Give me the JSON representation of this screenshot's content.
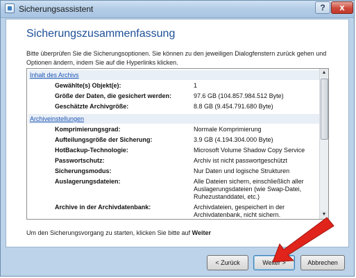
{
  "window": {
    "title": "Sicherungsassistent",
    "help_symbol": "?",
    "close_symbol": "x"
  },
  "page": {
    "title": "Sicherungszusammenfassung",
    "intro": "Bitte überprüfen Sie die Sicherungsoptionen. Sie können zu den jeweiligen Dialogfenstern zurück gehen und Optionen ändern, indem Sie auf die Hyperlinks klicken."
  },
  "sections": [
    {
      "title": "Inhalt des Archivs",
      "rows": [
        {
          "label": "Gewählte(s) Objekt(e):",
          "value": "1"
        },
        {
          "label": "Größe der Daten, die gesichert werden:",
          "value": "97.6 GB (104.857.984.512 Byte)"
        },
        {
          "label": "Geschätzte Archivgröße:",
          "value": "8.8 GB (9.454.791.680 Byte)"
        }
      ]
    },
    {
      "title": "Archiveinstellungen",
      "rows": [
        {
          "label": "Komprimierungsgrad:",
          "value": "Normale Komprimierung"
        },
        {
          "label": "Aufteilungsgröße der Sicherung:",
          "value": "3.9 GB (4.194.304.000 Byte)"
        },
        {
          "label": "HotBackup-Technologie:",
          "value": "Microsoft Volume Shadow Copy Service"
        },
        {
          "label": "Passwortschutz:",
          "value": "Archiv ist nicht passwortgeschützt"
        },
        {
          "label": "Sicherungsmodus:",
          "value": "Nur Daten und logische Strukturen"
        },
        {
          "label": "Auslagerungsdateien:",
          "value": "Alle Dateien sichern, einschließlich aller Auslagerungsdateien (wie Swap-Datei, Ruhezustanddatei, etc.)"
        },
        {
          "label": "Archive in der Archivdatenbank:",
          "value": "Archivdateien, gespeichert in der Archivdatenbank, nicht sichern."
        }
      ]
    }
  ],
  "footer": {
    "text_prefix": "Um den Sicherungsvorgang zu starten, klicken Sie bitte auf",
    "text_bold": "Weiter"
  },
  "buttons": {
    "back": "< Zurück",
    "next": "Weiter >",
    "cancel": "Abbrechen"
  },
  "colors": {
    "arrow": "#e0241b",
    "link": "#1d56b6",
    "title": "#1d4f97"
  },
  "icons": {
    "scroll_up": "▲",
    "scroll_down": "▼"
  }
}
